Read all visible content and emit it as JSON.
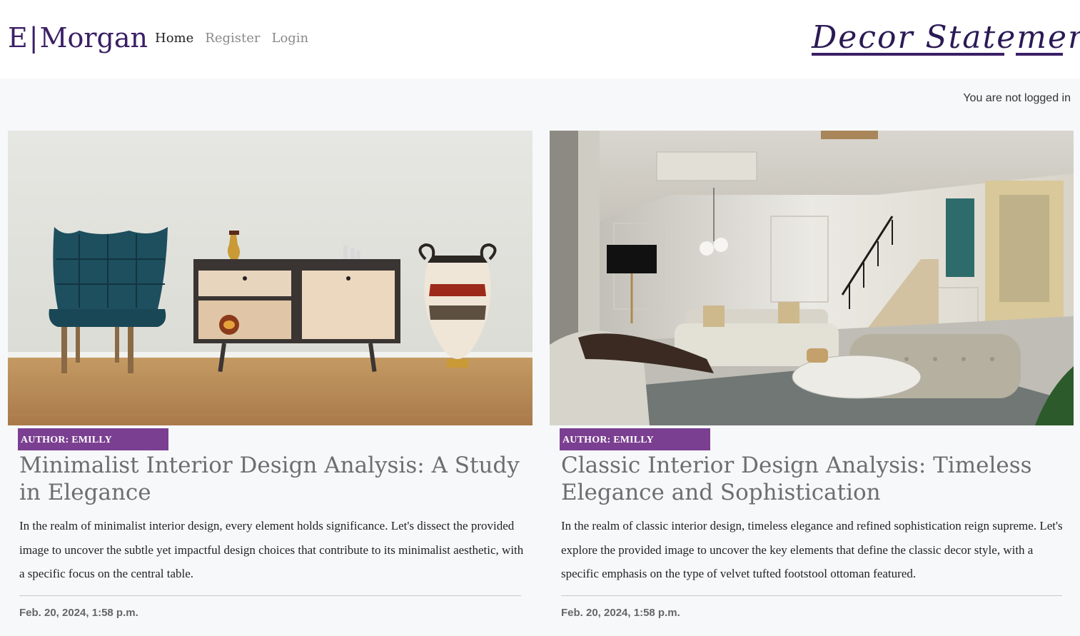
{
  "header": {
    "logo_main": "E",
    "logo_sep": "|",
    "logo_tail": "Morgan",
    "nav": [
      {
        "label": "Home",
        "active": true
      },
      {
        "label": "Register",
        "active": false
      },
      {
        "label": "Login",
        "active": false
      }
    ],
    "brand": "Decor Statement",
    "accent_color": "#3a1f66"
  },
  "login_status": "You are not logged in",
  "posts": [
    {
      "author": "AUTHOR: EMILLY",
      "title": "Minimalist Interior Design Analysis: A Study in Elegance",
      "excerpt": "In the realm of minimalist interior design, every element holds significance. Let's dissect the provided image to uncover the subtle yet impactful design choices that contribute to its minimalist aesthetic, with a specific focus on the central table.",
      "date": "Feb. 20, 2024, 1:58 p.m.",
      "image_icon": "minimalist-room-image"
    },
    {
      "author": "AUTHOR: EMILLY",
      "title": "Classic Interior Design Analysis: Timeless Elegance and Sophistication",
      "excerpt": "In the realm of classic interior design, timeless elegance and refined sophistication reign supreme. Let's explore the provided image to uncover the key elements that define the classic decor style, with a specific emphasis on the type of velvet tufted footstool ottoman featured.",
      "date": "Feb. 20, 2024, 1:58 p.m.",
      "image_icon": "classic-living-room-image"
    }
  ],
  "colors": {
    "author_badge": "#7b3f91",
    "page_bg": "#f7f8fa"
  }
}
